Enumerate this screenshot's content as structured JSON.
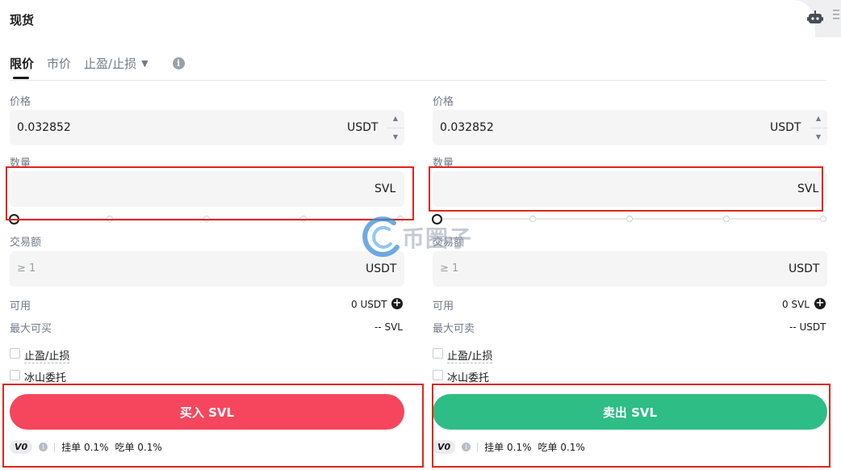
{
  "header": {
    "title": "现货",
    "robot_icon": "robot-icon",
    "menu_icon": "menu-icon"
  },
  "order_tabs": [
    {
      "label": "限价",
      "active": true
    },
    {
      "label": "市价",
      "active": false
    },
    {
      "label": "止盈/止损",
      "active": false,
      "has_dropdown": true
    }
  ],
  "colors": {
    "buy": "#f6465d",
    "sell": "#2ebd85",
    "highlight": "#e0261b"
  },
  "buy": {
    "price_label": "价格",
    "price_value": "0.032852",
    "price_unit": "USDT",
    "amount_label": "数量",
    "amount_unit": "SVL",
    "total_label": "交易额",
    "total_placeholder": "≥ 1",
    "total_unit": "USDT",
    "available_label": "可用",
    "available_value": "0 USDT",
    "max_label": "最大可买",
    "max_value": "-- SVL",
    "tpsl_label": "止盈/止损",
    "iceberg_label": "冰山委托",
    "button_label": "买入 SVL",
    "vip": "V0",
    "maker_fee": "挂单 0.1%",
    "taker_fee": "吃单 0.1%"
  },
  "sell": {
    "price_label": "价格",
    "price_value": "0.032852",
    "price_unit": "USDT",
    "amount_label": "数量",
    "amount_unit": "SVL",
    "total_label": "交易额",
    "total_placeholder": "≥ 1",
    "total_unit": "USDT",
    "available_label": "可用",
    "available_value": "0 SVL",
    "max_label": "最大可卖",
    "max_value": "-- USDT",
    "tpsl_label": "止盈/止损",
    "iceberg_label": "冰山委托",
    "button_label": "卖出 SVL",
    "vip": "V0",
    "maker_fee": "挂单 0.1%",
    "taker_fee": "吃单 0.1%"
  },
  "watermark": {
    "text": "币圈子"
  }
}
